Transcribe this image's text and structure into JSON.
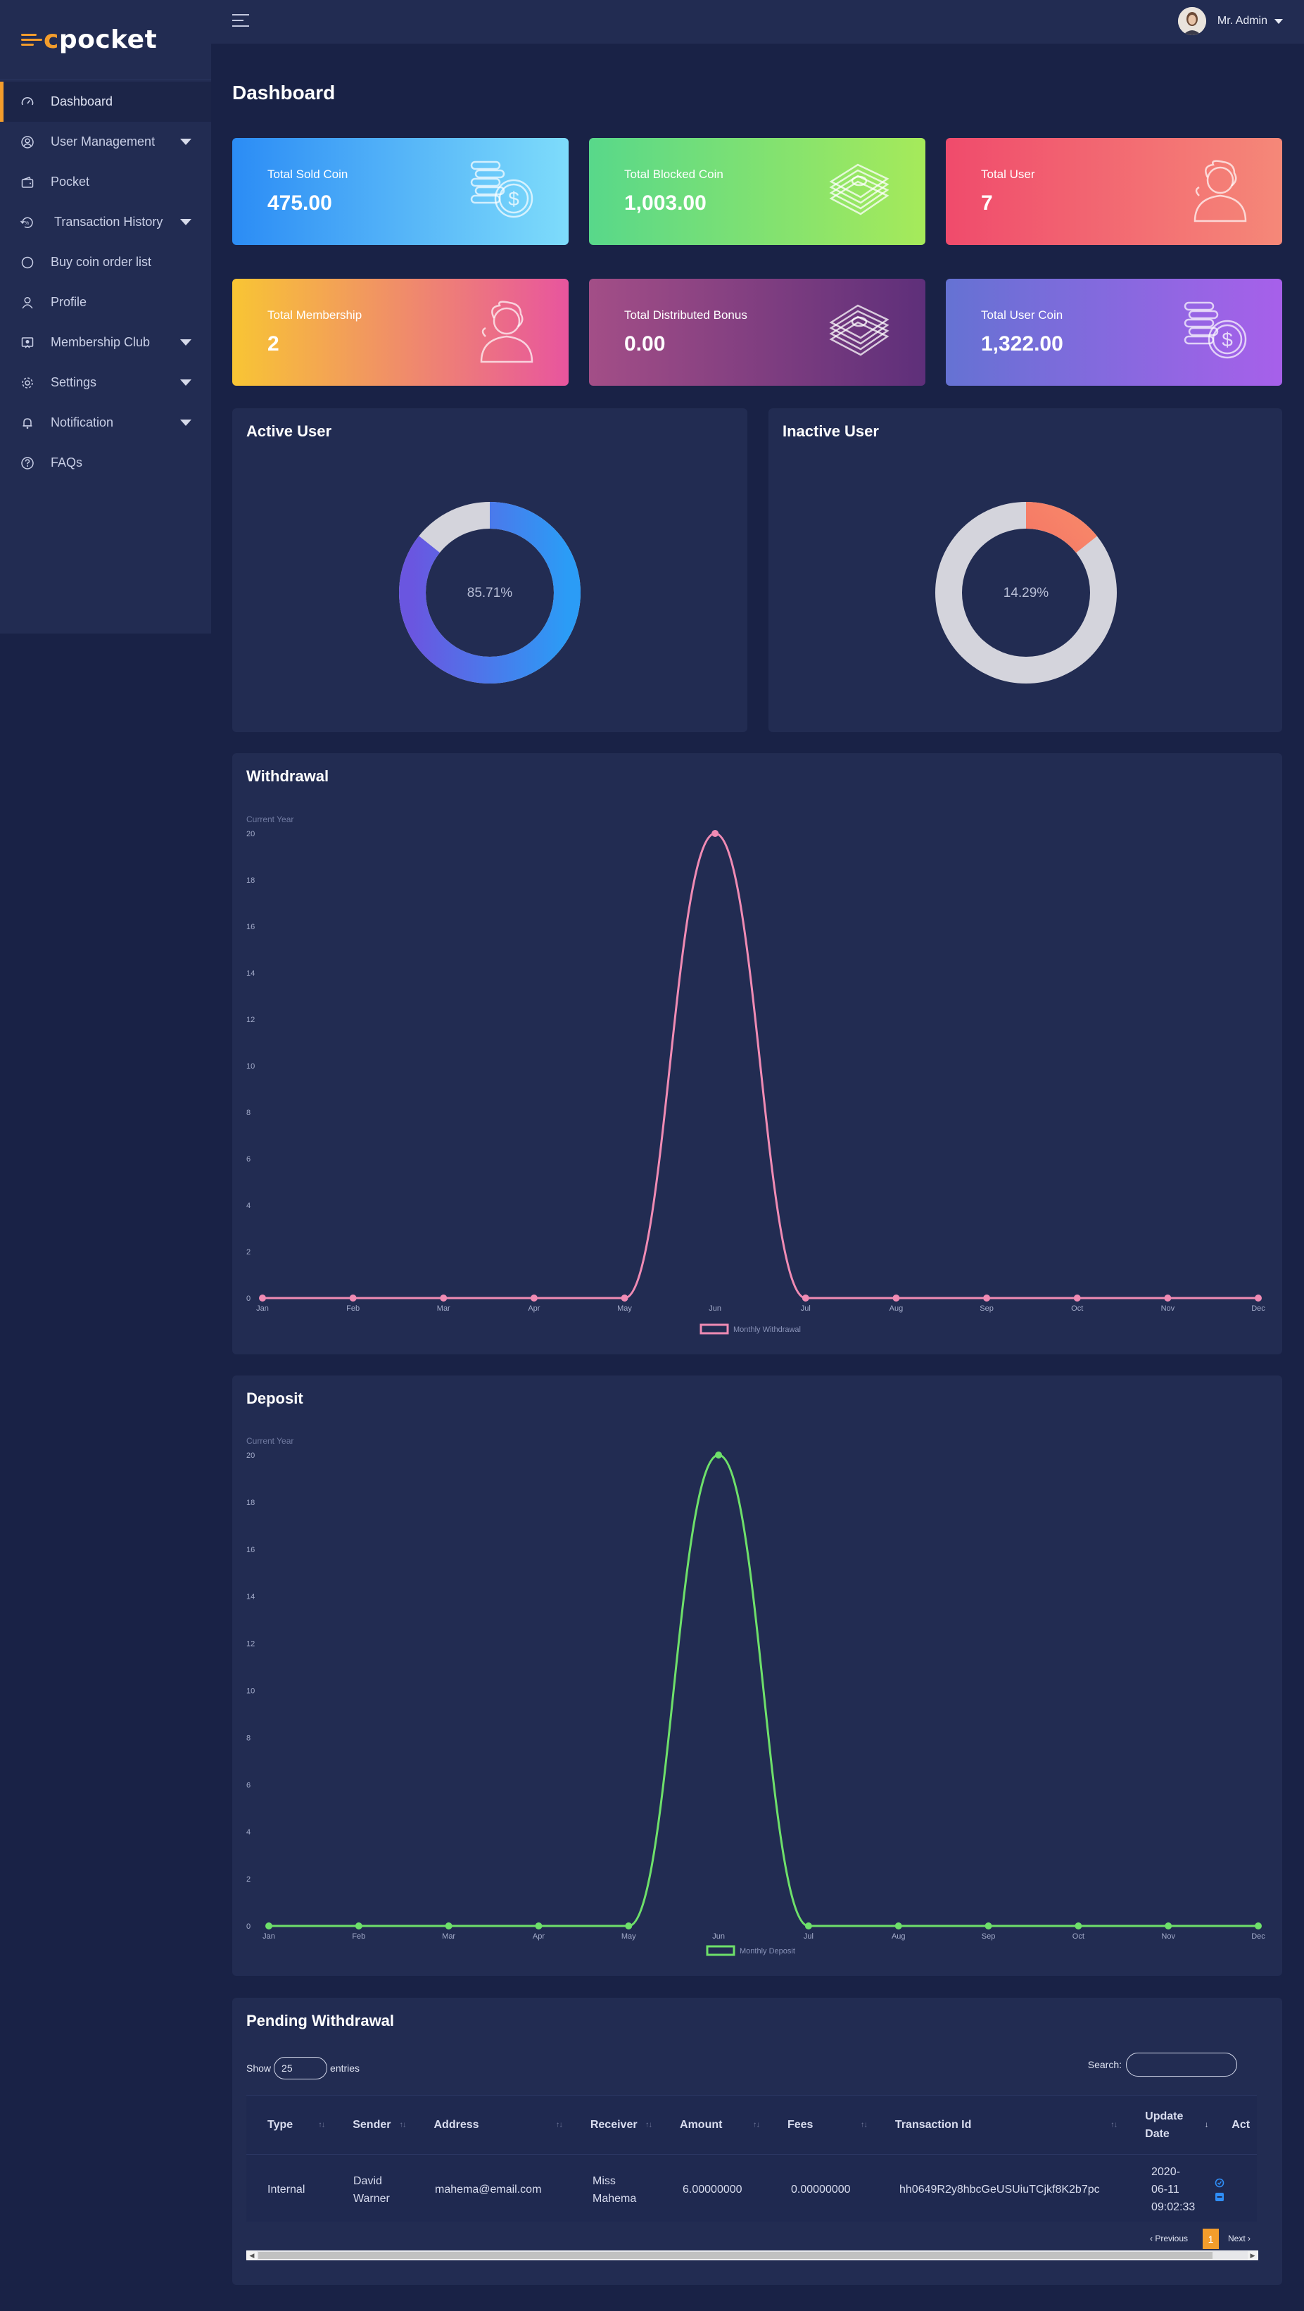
{
  "app": {
    "brand_c": "c",
    "brand_rest": "pocket"
  },
  "topbar": {
    "user_name": "Mr. Admin"
  },
  "sidebar": {
    "items": [
      {
        "label": "Dashboard",
        "icon": "speedometer-icon",
        "active": true
      },
      {
        "label": "User Management",
        "icon": "user-circle-icon",
        "caret": true
      },
      {
        "label": "Pocket",
        "icon": "wallet-icon"
      },
      {
        "label": "Transaction History",
        "icon": "history-icon",
        "caret": true
      },
      {
        "label": "Buy coin order list",
        "icon": "circle-icon"
      },
      {
        "label": "Profile",
        "icon": "person-icon"
      },
      {
        "label": "Membership Club",
        "icon": "badge-icon",
        "caret": true
      },
      {
        "label": "Settings",
        "icon": "gear-icon",
        "caret": true
      },
      {
        "label": "Notification",
        "icon": "bell-icon",
        "caret": true
      },
      {
        "label": "FAQs",
        "icon": "question-icon"
      }
    ]
  },
  "page": {
    "title": "Dashboard"
  },
  "cards": [
    {
      "label": "Total Sold Coin",
      "value": "475.00",
      "icon": "coins-dollar-icon",
      "colors": [
        "#2b8cf5",
        "#7edcfb"
      ]
    },
    {
      "label": "Total Blocked Coin",
      "value": "1,003.00",
      "icon": "cash-stack-icon",
      "colors": [
        "#58d88a",
        "#a6ea5a"
      ]
    },
    {
      "label": "Total User",
      "value": "7",
      "icon": "user-icon",
      "colors": [
        "#f04b6c",
        "#f58878"
      ]
    },
    {
      "label": "Total Membership",
      "value": "2",
      "icon": "user-icon",
      "colors": [
        "#f8c534",
        "#e8559e"
      ]
    },
    {
      "label": "Total Distributed Bonus",
      "value": "0.00",
      "icon": "cash-stack-icon",
      "colors": [
        "#a34e87",
        "#5e2f7a"
      ]
    },
    {
      "label": "Total User Coin",
      "value": "1,322.00",
      "icon": "coins-dollar-icon",
      "colors": [
        "#6572d3",
        "#a760ea"
      ]
    }
  ],
  "active_user": {
    "title": "Active User",
    "percent_label": "85.71%",
    "percent": 85.71
  },
  "inactive_user": {
    "title": "Inactive User",
    "percent_label": "14.29%",
    "percent": 14.29
  },
  "chart_data": [
    {
      "type": "line",
      "panel_title": "Withdrawal",
      "subtitle": "Current Year",
      "x": [
        "Jan",
        "Feb",
        "Mar",
        "Apr",
        "May",
        "Jun",
        "Jul",
        "Aug",
        "Sep",
        "Oct",
        "Nov",
        "Dec"
      ],
      "series": [
        {
          "name": "Monthly Withdrawal",
          "values": [
            0,
            0,
            0,
            0,
            0,
            20,
            0,
            0,
            0,
            0,
            0,
            0
          ],
          "color": "#f08bb4"
        }
      ],
      "y_ticks": [
        "0",
        "2",
        "4",
        "6",
        "8",
        "10",
        "12",
        "14",
        "16",
        "18",
        "20"
      ],
      "ylim": [
        0,
        20
      ],
      "legend": "bottom"
    },
    {
      "type": "line",
      "panel_title": "Deposit",
      "subtitle": "Current Year",
      "x": [
        "Jan",
        "Feb",
        "Mar",
        "Apr",
        "May",
        "Jun",
        "Jul",
        "Aug",
        "Sep",
        "Oct",
        "Nov",
        "Dec"
      ],
      "series": [
        {
          "name": "Monthly Deposit",
          "values": [
            0,
            0,
            0,
            0,
            0,
            20,
            0,
            0,
            0,
            0,
            0,
            0
          ],
          "color": "#6ee06a"
        }
      ],
      "y_ticks": [
        "0",
        "2",
        "4",
        "6",
        "8",
        "10",
        "12",
        "14",
        "16",
        "18",
        "20"
      ],
      "ylim": [
        0,
        20
      ],
      "legend": "bottom"
    }
  ],
  "pending": {
    "title": "Pending Withdrawal",
    "show_label": "Show",
    "entries_value": "25",
    "entries_label": "entries",
    "search_label": "Search:",
    "headers": [
      "Type",
      "Sender",
      "Address",
      "Receiver",
      "Amount",
      "Fees",
      "Transaction Id",
      "Update Date",
      "Act"
    ],
    "rows": [
      {
        "type": "Internal",
        "sender": "David Warner",
        "address": "mahema@email.com",
        "receiver": "Miss Mahema",
        "amount": "6.00000000",
        "fees": "0.00000000",
        "transaction_id": "hh0649R2y8hbcGeUSUiuTCjkf8K2b7pc",
        "update_date": "2020-06-11 09:02:33"
      }
    ],
    "pagination": {
      "previous": "‹ Previous",
      "page": "1",
      "next": "Next ›"
    }
  }
}
